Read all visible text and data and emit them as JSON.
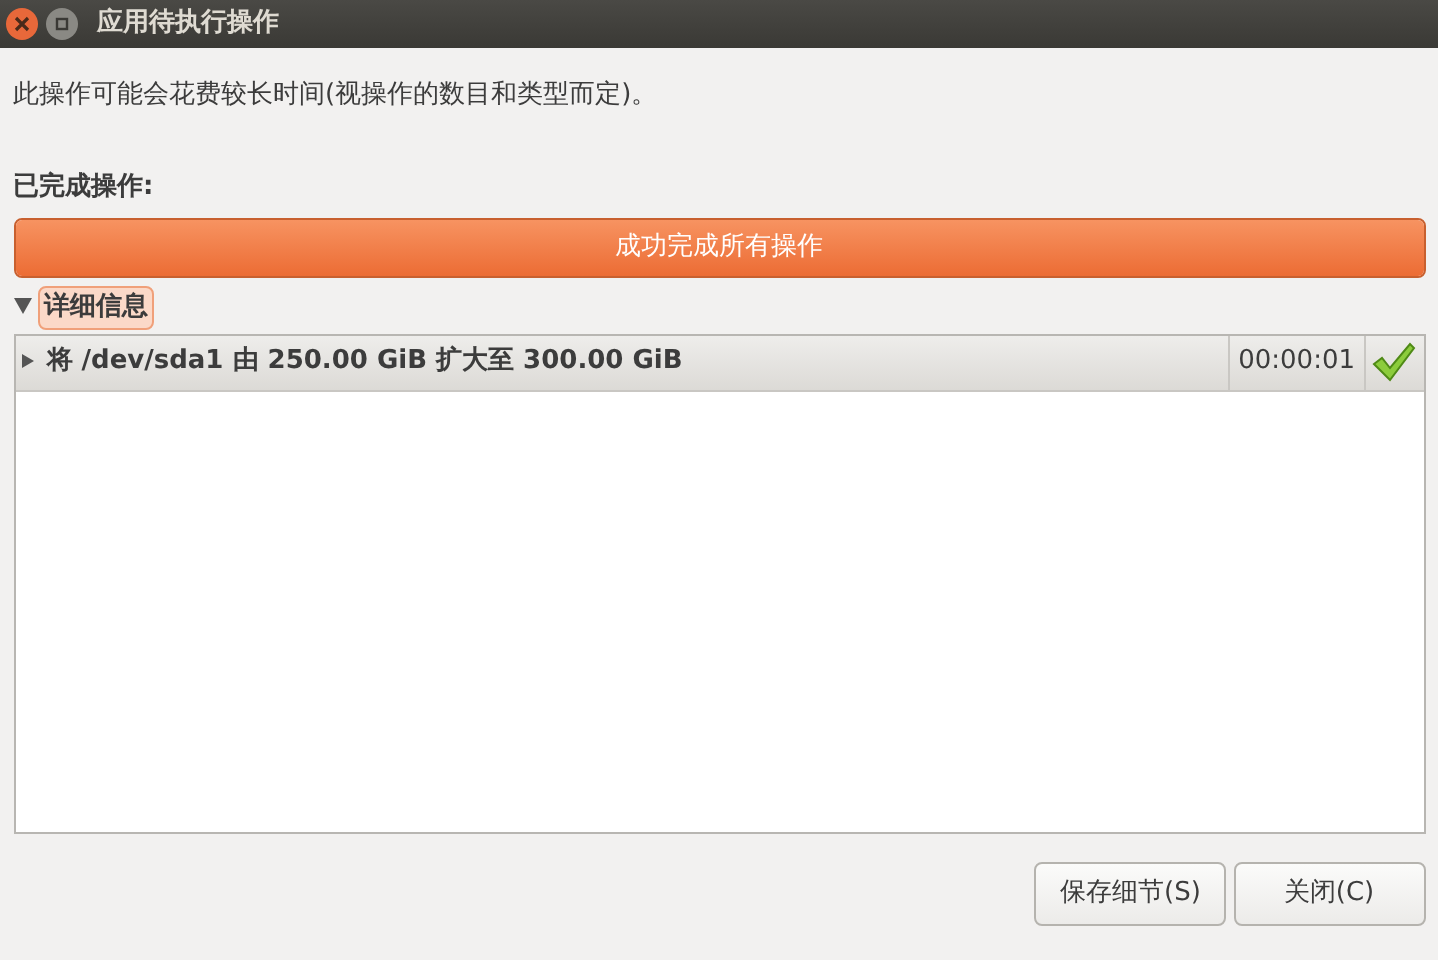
{
  "window": {
    "title": "应用待执行操作"
  },
  "description": "此操作可能会花费较长时间(视操作的数目和类型而定)。",
  "completed_label": "已完成操作:",
  "progress": {
    "text": "成功完成所有操作",
    "level": 1
  },
  "details": {
    "label": "详细信息",
    "expanded": true
  },
  "operations": [
    {
      "text": "将 /dev/sda1 由 250.00 GiB 扩大至 300.00 GiB",
      "time": "00:00:01",
      "expanded": false,
      "done": true
    }
  ],
  "buttons": [
    "保存细节(S)",
    "关闭(C)"
  ]
}
